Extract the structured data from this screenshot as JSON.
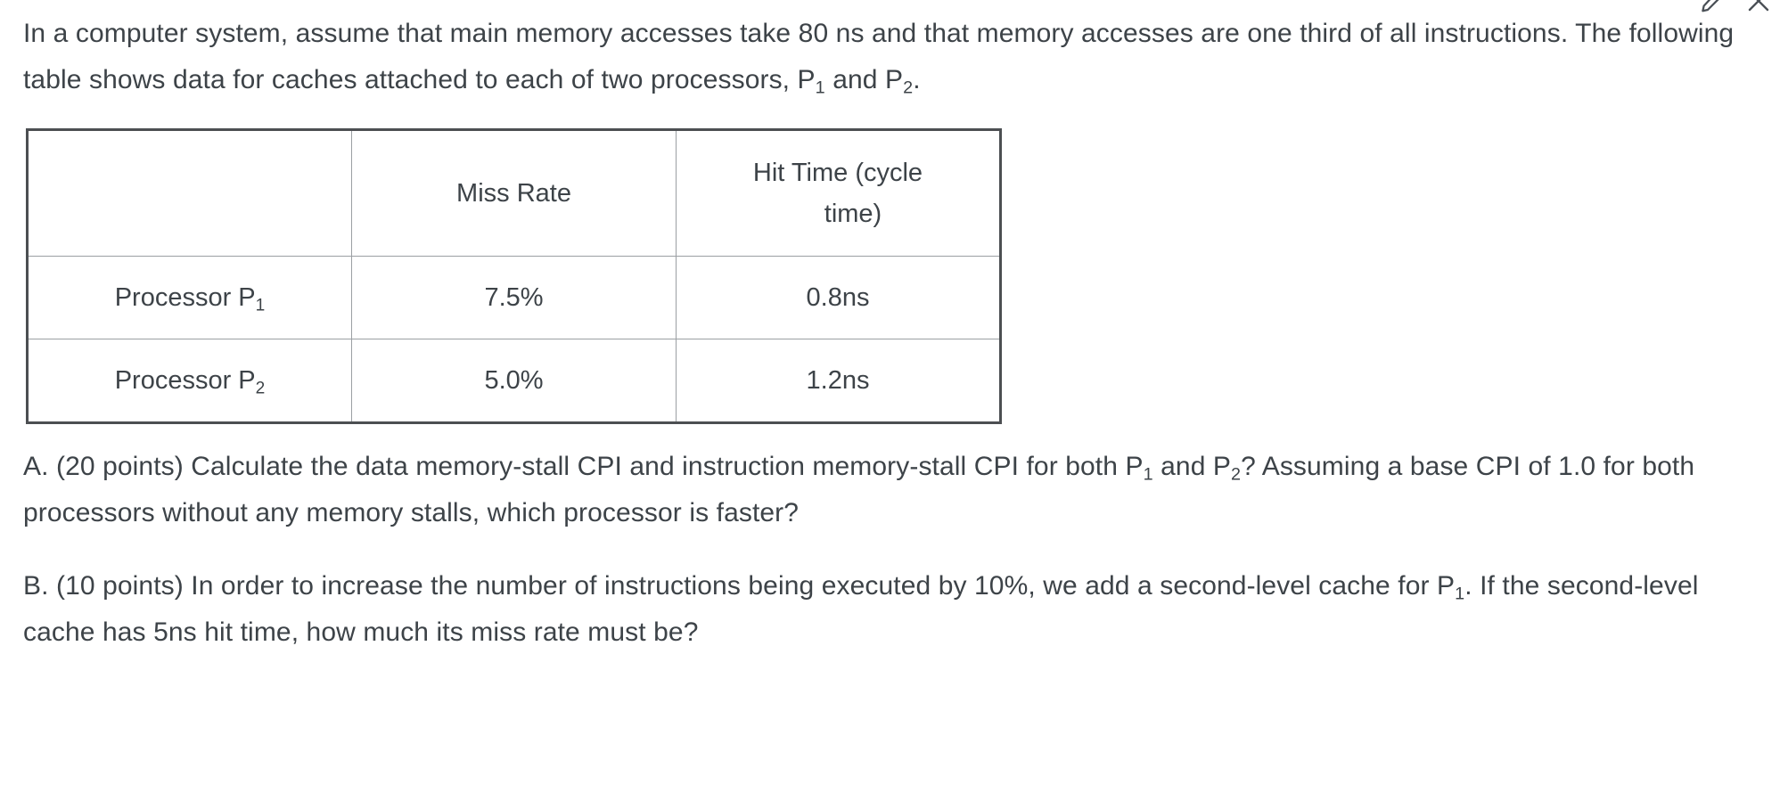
{
  "document": {
    "intro": {
      "segments": [
        {
          "t": "In a computer system, assume that main memory accesses take 80 ns and that memory accesses are one third of all instructions. The following table shows data for caches attached to each of two processors, P"
        },
        {
          "t": "1",
          "sub": true
        },
        {
          "t": " and P"
        },
        {
          "t": "2",
          "sub": true
        },
        {
          "t": "."
        }
      ],
      "plain": "In a computer system, assume that main memory accesses take 80 ns and that memory accesses are one third of all instructions. The following table shows data for caches attached to each of two processors, P1 and P2."
    },
    "table": {
      "headers": {
        "corner": "",
        "miss_rate": "Miss Rate",
        "hit_time_line1": "Hit Time   (cycle",
        "hit_time_line2": "time)"
      },
      "rows": [
        {
          "label_prefix": "Processor P",
          "label_sub": "1",
          "miss_rate": "7.5%",
          "hit_time": "0.8ns"
        },
        {
          "label_prefix": "Processor P",
          "label_sub": "2",
          "miss_rate": "5.0%",
          "hit_time": "1.2ns"
        }
      ]
    },
    "part_a": {
      "segments": [
        {
          "t": "A. (20 points) Calculate the data memory-stall CPI and instruction memory-stall CPI for both P"
        },
        {
          "t": "1",
          "sub": true
        },
        {
          "t": " and P"
        },
        {
          "t": "2",
          "sub": true
        },
        {
          "t": "? Assuming a base CPI of 1.0 for both processors without any memory stalls, which processor is faster?"
        }
      ],
      "plain": "A. (20 points) Calculate the data memory-stall CPI and instruction memory-stall CPI for both P1 and P2? Assuming a base CPI of 1.0 for both processors without any memory stalls, which processor is faster?"
    },
    "part_b": {
      "segments": [
        {
          "t": "B. (10 points) In order to increase the number of instructions being executed by 10%, we add a second-level cache for P"
        },
        {
          "t": "1",
          "sub": true
        },
        {
          "t": ". If the second-level cache has 5ns hit time,  how much its miss rate must be?"
        }
      ],
      "plain": "B. (10 points) In order to increase the number of instructions being executed by 10%, we add a second-level cache for P1. If the second-level cache has 5ns hit time,  how much its miss rate must be?"
    }
  },
  "toolbar": {
    "edit_icon": "pencil-edit-icon",
    "close_icon": "close-x-icon"
  },
  "colors": {
    "text": "#3d4348",
    "table_outer_border": "#4c4f52",
    "table_inner_border": "#9b9fa3",
    "icon": "#4a5056",
    "background": "#ffffff"
  }
}
